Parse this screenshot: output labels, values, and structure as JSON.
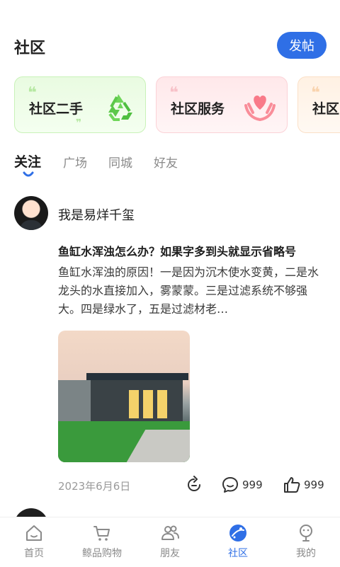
{
  "header": {
    "title": "社区",
    "post_button": "发帖"
  },
  "cards": [
    {
      "label": "社区二手",
      "icon": "recycle-icon"
    },
    {
      "label": "社区服务",
      "icon": "heart-hands-icon"
    },
    {
      "label": "社区"
    }
  ],
  "tabs": [
    {
      "label": "关注",
      "active": true
    },
    {
      "label": "广场"
    },
    {
      "label": "同城"
    },
    {
      "label": "好友"
    }
  ],
  "post": {
    "username": "我是易烊千玺",
    "title": "鱼缸水浑浊怎么办？如果字多到头就显示省略号",
    "body": "鱼缸水浑浊的原因！一是因为沉木使水变黄，二是水龙头的水直接加入，雾蒙蒙。三是过滤系统不够强大。四是绿水了，五是过滤材老…",
    "date": "2023年6月6日",
    "comments": "999",
    "likes": "999"
  },
  "nav": [
    {
      "label": "首页",
      "icon": "home-icon"
    },
    {
      "label": "鲸品购物",
      "icon": "cart-icon"
    },
    {
      "label": "朋友",
      "icon": "friends-icon"
    },
    {
      "label": "社区",
      "icon": "community-icon",
      "active": true
    },
    {
      "label": "我的",
      "icon": "profile-icon"
    }
  ],
  "colors": {
    "accent": "#2f6fe6",
    "inactive": "#8a8a8a"
  }
}
